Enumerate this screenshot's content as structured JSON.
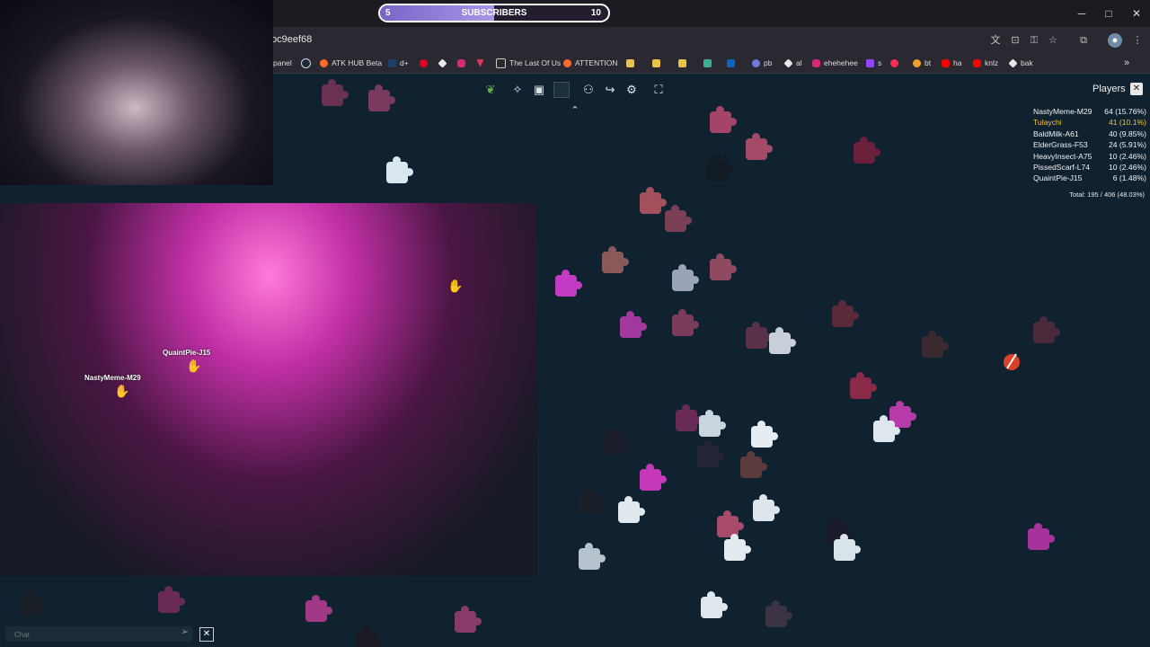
{
  "colors": {
    "background": "#102230",
    "accent_bar": "#7b64c8",
    "current_player": "#f5c242"
  },
  "subscriber_goal": {
    "start": "5",
    "label": "SUBSCRIBERS",
    "goal": "10",
    "progress_fraction": 0.5
  },
  "window_controls": {
    "minimize": "─",
    "maximize": "□",
    "close": "✕"
  },
  "address_bar": {
    "url_fragment": "oc9eef68"
  },
  "bookmarks": [
    {
      "label": "panel",
      "icon": "panel-icon"
    },
    {
      "label": "",
      "icon": "steam-icon"
    },
    {
      "label": "ATK HUB Beta",
      "icon": "atk-hub-icon"
    },
    {
      "label": "d+",
      "icon": "d-plus-icon"
    },
    {
      "label": "",
      "icon": "pinterest-icon"
    },
    {
      "label": "",
      "icon": "diamond-icon"
    },
    {
      "label": "",
      "icon": "instagram-icon"
    },
    {
      "label": "",
      "icon": "triangle-icon"
    },
    {
      "label": "The Last Of Us",
      "icon": "tlou-icon"
    },
    {
      "label": "ATTENTION",
      "icon": "attention-icon"
    },
    {
      "label": "",
      "icon": "folder-icon"
    },
    {
      "label": "",
      "icon": "folder-icon"
    },
    {
      "label": "",
      "icon": "folder-icon"
    },
    {
      "label": "",
      "icon": "folder-icon"
    },
    {
      "label": "",
      "icon": "linkedin-icon"
    },
    {
      "label": "pb",
      "icon": "pb-icon"
    },
    {
      "label": "al",
      "icon": "al-icon"
    },
    {
      "label": "ehehehee",
      "icon": "instagram-icon"
    },
    {
      "label": "s",
      "icon": "twitch-icon"
    },
    {
      "label": "bt",
      "icon": "bt-icon"
    },
    {
      "label": "ha",
      "icon": "youtube-icon"
    },
    {
      "label": "knlz",
      "icon": "youtube-icon"
    },
    {
      "label": "bak",
      "icon": "bak-icon"
    }
  ],
  "toolbar": {
    "icons": [
      "leaf-icon",
      "puzzle-piece-icon",
      "image-preview-icon",
      "background-color-icon",
      "players-icon",
      "share-icon",
      "settings-icon",
      "fullscreen-icon"
    ],
    "collapse_glyph": "⌃"
  },
  "players_panel": {
    "title": "Players",
    "close": "✕",
    "players": [
      {
        "name": "NastyMeme-M29",
        "score": "64 (15.76%)",
        "is_self": false
      },
      {
        "name": "Tulaychi",
        "score": "41 (10.1%)",
        "is_self": true
      },
      {
        "name": "BaldMilk-A61",
        "score": "40 (9.85%)",
        "is_self": false
      },
      {
        "name": "ElderGrass-F53",
        "score": "24 (5.91%)",
        "is_self": false
      },
      {
        "name": "HeavyInsect-A75",
        "score": "10 (2.46%)",
        "is_self": false
      },
      {
        "name": "PissedScarf-L74",
        "score": "10 (2.46%)",
        "is_self": false
      },
      {
        "name": "QuaintPie-J15",
        "score": "6 (1.48%)",
        "is_self": false
      }
    ],
    "total": "Total: 195 / 406 (48.03%)"
  },
  "cursors": [
    {
      "name": "QuaintPie-J15"
    },
    {
      "name": "NastyMeme-M29"
    }
  ],
  "chat": {
    "placeholder": "Chat",
    "send_icon": "send-icon",
    "close": "✕"
  }
}
